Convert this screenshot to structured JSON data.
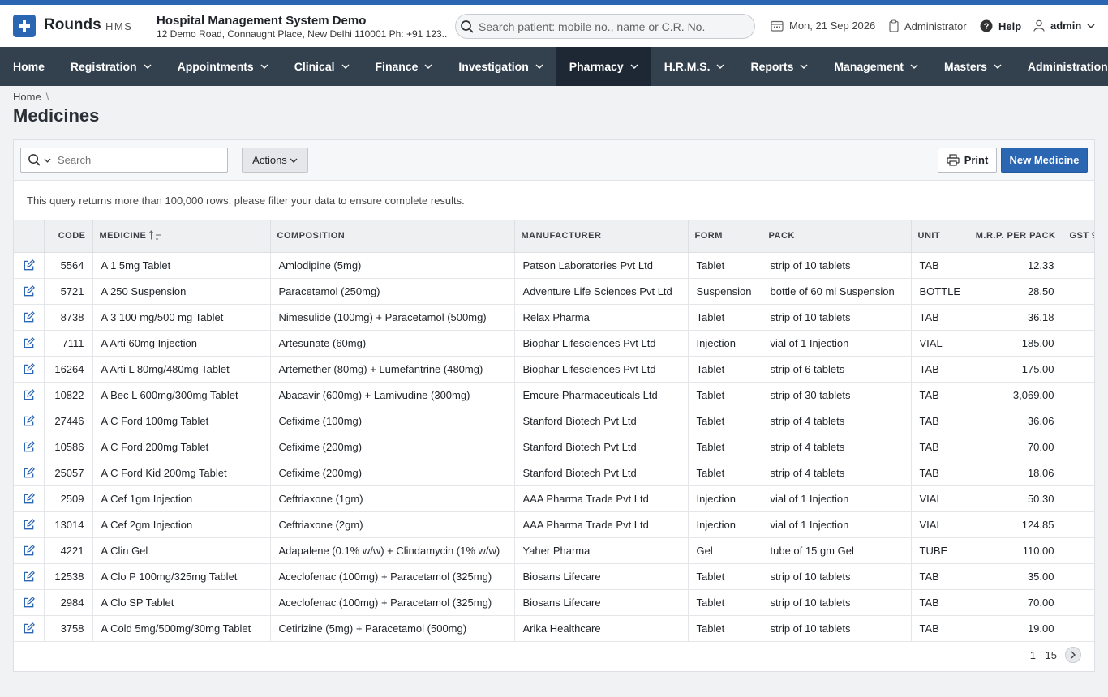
{
  "app": {
    "logo_text": "Rounds",
    "logo_sub": "HMS",
    "org_title": "Hospital Management System Demo",
    "org_address": "12 Demo Road, Connaught Place, New Delhi 110001 Ph: +91 123..."
  },
  "header": {
    "search_placeholder": "Search patient: mobile no., name or C.R. No.",
    "date": "Mon, 21 Sep 2026",
    "role": "Administrator",
    "help": "Help",
    "user": "admin"
  },
  "nav": {
    "items": [
      {
        "label": "Home",
        "has_menu": false
      },
      {
        "label": "Registration",
        "has_menu": true
      },
      {
        "label": "Appointments",
        "has_menu": true
      },
      {
        "label": "Clinical",
        "has_menu": true
      },
      {
        "label": "Finance",
        "has_menu": true
      },
      {
        "label": "Investigation",
        "has_menu": true
      },
      {
        "label": "Pharmacy",
        "has_menu": true,
        "active": true
      },
      {
        "label": "H.R.M.S.",
        "has_menu": true
      },
      {
        "label": "Reports",
        "has_menu": true
      },
      {
        "label": "Management",
        "has_menu": true
      },
      {
        "label": "Masters",
        "has_menu": true
      },
      {
        "label": "Administration",
        "has_menu": true
      }
    ]
  },
  "breadcrumb": {
    "home": "Home",
    "separator": "\\"
  },
  "page": {
    "title": "Medicines"
  },
  "toolbar": {
    "search_placeholder": "Search",
    "actions_label": "Actions",
    "print_label": "Print",
    "new_label": "New Medicine"
  },
  "notice": "This query returns more than 100,000 rows, please filter your data to ensure complete results.",
  "table": {
    "columns": [
      "CODE",
      "MEDICINE",
      "COMPOSITION",
      "MANUFACTURER",
      "FORM",
      "PACK",
      "UNIT",
      "M.R.P. PER PACK",
      "GST %"
    ],
    "rows": [
      [
        "5564",
        "A 1 5mg Tablet",
        "Amlodipine (5mg)",
        "Patson Laboratories Pvt Ltd",
        "Tablet",
        "strip of 10 tablets",
        "TAB",
        "12.33"
      ],
      [
        "5721",
        "A 250 Suspension",
        "Paracetamol (250mg)",
        "Adventure Life Sciences Pvt Ltd",
        "Suspension",
        "bottle of 60 ml Suspension",
        "BOTTLE",
        "28.50"
      ],
      [
        "8738",
        "A 3 100 mg/500 mg Tablet",
        "Nimesulide (100mg) + Paracetamol (500mg)",
        "Relax Pharma",
        "Tablet",
        "strip of 10 tablets",
        "TAB",
        "36.18"
      ],
      [
        "7111",
        "A Arti 60mg Injection",
        "Artesunate (60mg)",
        "Biophar Lifesciences Pvt Ltd",
        "Injection",
        "vial of 1 Injection",
        "VIAL",
        "185.00"
      ],
      [
        "16264",
        "A Arti L 80mg/480mg Tablet",
        "Artemether (80mg) + Lumefantrine (480mg)",
        "Biophar Lifesciences Pvt Ltd",
        "Tablet",
        "strip of 6 tablets",
        "TAB",
        "175.00"
      ],
      [
        "10822",
        "A Bec L 600mg/300mg Tablet",
        "Abacavir (600mg) + Lamivudine (300mg)",
        "Emcure Pharmaceuticals Ltd",
        "Tablet",
        "strip of 30 tablets",
        "TAB",
        "3,069.00"
      ],
      [
        "27446",
        "A C Ford 100mg Tablet",
        "Cefixime (100mg)",
        "Stanford Biotech Pvt Ltd",
        "Tablet",
        "strip of 4 tablets",
        "TAB",
        "36.06"
      ],
      [
        "10586",
        "A C Ford 200mg Tablet",
        "Cefixime (200mg)",
        "Stanford Biotech Pvt Ltd",
        "Tablet",
        "strip of 4 tablets",
        "TAB",
        "70.00"
      ],
      [
        "25057",
        "A C Ford Kid 200mg Tablet",
        "Cefixime (200mg)",
        "Stanford Biotech Pvt Ltd",
        "Tablet",
        "strip of 4 tablets",
        "TAB",
        "18.06"
      ],
      [
        "2509",
        "A Cef 1gm Injection",
        "Ceftriaxone (1gm)",
        "AAA Pharma Trade Pvt Ltd",
        "Injection",
        "vial of 1 Injection",
        "VIAL",
        "50.30"
      ],
      [
        "13014",
        "A Cef 2gm Injection",
        "Ceftriaxone (2gm)",
        "AAA Pharma Trade Pvt Ltd",
        "Injection",
        "vial of 1 Injection",
        "VIAL",
        "124.85"
      ],
      [
        "4221",
        "A Clin Gel",
        "Adapalene (0.1% w/w) + Clindamycin (1% w/w)",
        "Yaher Pharma",
        "Gel",
        "tube of 15 gm Gel",
        "TUBE",
        "110.00"
      ],
      [
        "12538",
        "A Clo P 100mg/325mg Tablet",
        "Aceclofenac (100mg) + Paracetamol (325mg)",
        "Biosans Lifecare",
        "Tablet",
        "strip of 10 tablets",
        "TAB",
        "35.00"
      ],
      [
        "2984",
        "A Clo SP Tablet",
        "Aceclofenac (100mg) + Paracetamol (325mg)",
        "Biosans Lifecare",
        "Tablet",
        "strip of 10 tablets",
        "TAB",
        "70.00"
      ],
      [
        "3758",
        "A Cold 5mg/500mg/30mg Tablet",
        "Cetirizine (5mg) + Paracetamol (500mg)",
        "Arika Healthcare",
        "Tablet",
        "strip of 10 tablets",
        "TAB",
        "19.00"
      ]
    ]
  },
  "pagination": {
    "range": "1 - 15"
  },
  "colors": {
    "accent": "#2b66b3",
    "nav_bg": "#33414f",
    "nav_active": "#1d2834"
  }
}
